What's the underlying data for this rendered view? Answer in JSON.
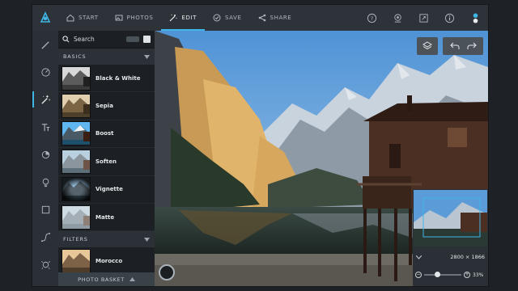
{
  "topbar": {
    "tabs": [
      {
        "label": "START",
        "icon": "home-icon"
      },
      {
        "label": "PHOTOS",
        "icon": "image-icon"
      },
      {
        "label": "EDIT",
        "icon": "magic-wand-icon",
        "active": true
      },
      {
        "label": "SAVE",
        "icon": "check-circle-icon"
      },
      {
        "label": "SHARE",
        "icon": "share-icon"
      }
    ],
    "right_icons": [
      "help-icon",
      "compare-icon",
      "fullscreen-icon",
      "info-icon",
      "toggle-switch-icon"
    ]
  },
  "leftnav": {
    "items": [
      "brush-icon",
      "adjust-icon",
      "magic-wand-icon",
      "text-icon",
      "sticker-icon",
      "bulb-icon",
      "frame-icon",
      "curve-icon",
      "face-icon"
    ],
    "active_index": 2
  },
  "panel": {
    "search_label": "Search",
    "basics_label": "BASICS",
    "filters_label": "FILTERS",
    "basics": [
      "Black & White",
      "Sepia",
      "Boost",
      "Soften",
      "Vignette",
      "Matte"
    ],
    "filters": [
      "Morocco"
    ],
    "basket_label": "PHOTO BASKET"
  },
  "navigator": {
    "dimensions": "2800 × 1866",
    "zoom": "33%",
    "zoom_level": 0.33
  },
  "colors": {
    "accent": "#3fb6e6",
    "topbar": "#2d3339",
    "panel": "#1c2024"
  }
}
